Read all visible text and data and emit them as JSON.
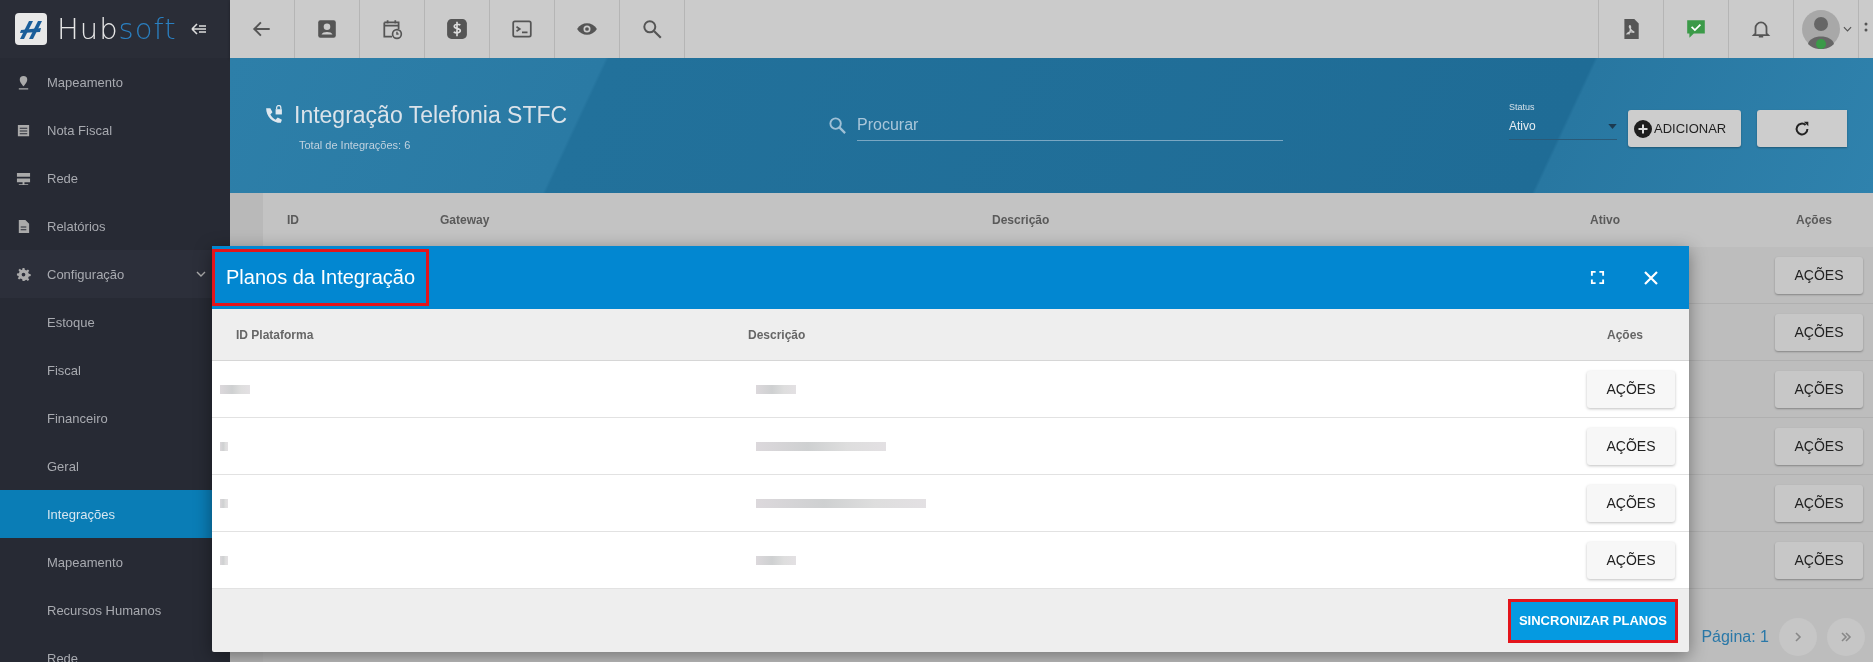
{
  "logo": {
    "part1": "Hub",
    "part2": "soft"
  },
  "sidebar": {
    "items": [
      {
        "label": "Mapeamento",
        "selected": false
      },
      {
        "label": "Nota Fiscal",
        "selected": false
      },
      {
        "label": "Rede",
        "selected": false
      },
      {
        "label": "Relatórios",
        "selected": false
      },
      {
        "label": "Configuração",
        "selected": false,
        "expanded": true,
        "children": [
          {
            "label": "Estoque",
            "selected": false
          },
          {
            "label": "Fiscal",
            "selected": false
          },
          {
            "label": "Financeiro",
            "selected": false
          },
          {
            "label": "Geral",
            "selected": false
          },
          {
            "label": "Integrações",
            "selected": true
          },
          {
            "label": "Mapeamento",
            "selected": false
          },
          {
            "label": "Recursos Humanos",
            "selected": false
          },
          {
            "label": "Rede",
            "selected": false
          }
        ]
      }
    ]
  },
  "header": {
    "title": "Integração Telefonia STFC",
    "subtitle": "Total de Integrações: 6",
    "search": {
      "placeholder": "Procurar"
    },
    "status": {
      "label": "Status",
      "value": "Ativo"
    },
    "add_button": "ADICIONAR"
  },
  "table": {
    "columns": [
      "ID",
      "Gateway",
      "Descrição",
      "Ativo",
      "Ações"
    ],
    "rows": [
      {
        "action": "AÇÕES"
      },
      {
        "action": "AÇÕES"
      },
      {
        "action": "AÇÕES"
      },
      {
        "action": "AÇÕES"
      },
      {
        "action": "AÇÕES"
      },
      {
        "action": "AÇÕES"
      }
    ],
    "pagination": "Página: 1"
  },
  "modal": {
    "title": "Planos da Integração",
    "title_highlighted": true,
    "columns": [
      "ID Plataforma",
      "Descrição",
      "Ações"
    ],
    "rows": [
      {
        "action": "AÇÕES"
      },
      {
        "action": "AÇÕES"
      },
      {
        "action": "AÇÕES"
      },
      {
        "action": "AÇÕES"
      }
    ],
    "sync_button": "SINCRONIZAR PLANOS",
    "sync_highlighted": true
  }
}
